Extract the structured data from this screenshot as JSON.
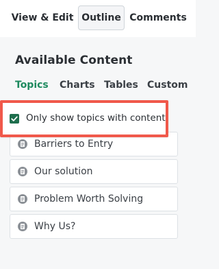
{
  "top_tabs": [
    {
      "label": "View & Edit"
    },
    {
      "label": "Outline"
    },
    {
      "label": "Comments"
    }
  ],
  "section": {
    "title": "Available Content"
  },
  "sub_tabs": [
    {
      "label": "Topics"
    },
    {
      "label": "Charts"
    },
    {
      "label": "Tables"
    },
    {
      "label": "Custom"
    }
  ],
  "filter": {
    "label": "Only show topics with content",
    "checked": true
  },
  "topics": [
    {
      "label": "Barriers to Entry",
      "icon": "document-icon"
    },
    {
      "label": "Our solution",
      "icon": "document-icon"
    },
    {
      "label": "Problem Worth Solving",
      "icon": "document-icon"
    },
    {
      "label": "Why Us?",
      "icon": "document-icon"
    }
  ],
  "colors": {
    "accent": "#1e8a5f",
    "checkbox": "#1e6e4d",
    "highlight": "#f0594b"
  }
}
